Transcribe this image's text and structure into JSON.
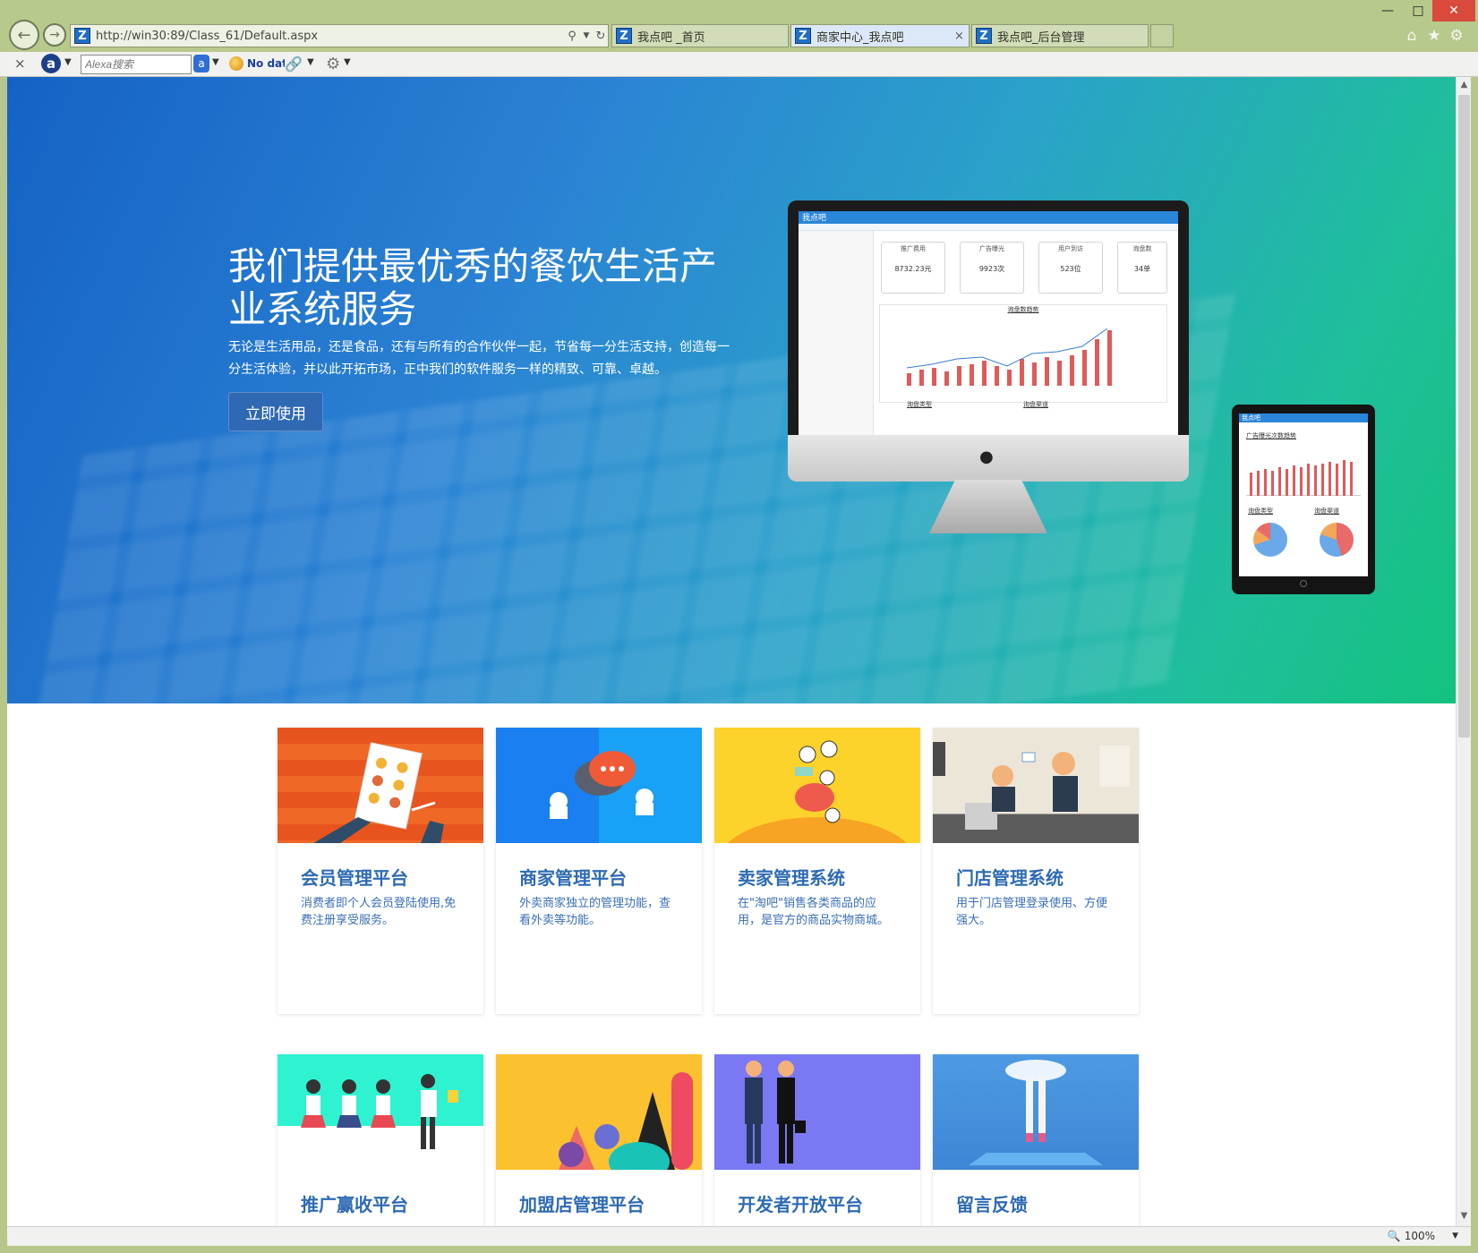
{
  "browser": {
    "url": "http://win30:89/Class_61/Default.aspx",
    "tabs": [
      {
        "label": "我点吧 _首页",
        "active": false
      },
      {
        "label": "商家中心_我点吧",
        "active": true
      },
      {
        "label": "我点吧_后台管理",
        "active": false
      }
    ],
    "toolbar": {
      "alexa_placeholder": "Alexa搜索",
      "no_data": "No data"
    },
    "zoom": "100%"
  },
  "hero": {
    "title": "我们提供最优秀的餐饮生活产业系统服务",
    "subtitle": "无论是生活用品，还是食品，还有与所有的合作伙伴一起，节省每一分生活支持，创造每一分生活体验，并以此开拓市场，正中我们的软件服务一样的精致、可靠、卓越。",
    "button": "立即使用",
    "mock_monitor": {
      "brand": "我点吧",
      "cards": [
        {
          "title": "推广费用",
          "value": "8732.23元"
        },
        {
          "title": "广告曝光",
          "value": "9923次"
        },
        {
          "title": "用户到访",
          "value": "523位"
        },
        {
          "title": "询盘数",
          "value": "34单"
        }
      ],
      "chart_title": "询盘数趋势",
      "sub_titles": [
        "询盘类型",
        "询盘渠道"
      ]
    },
    "mock_tablet": {
      "brand": "我点吧",
      "chart_title": "广告曝光次数趋势",
      "sub_titles": [
        "询盘类型",
        "询盘渠道"
      ]
    }
  },
  "cards": [
    {
      "title": "会员管理平台",
      "desc": "消费者即个人会员登陆使用,免费注册享受服务。",
      "bg": "#e8541e"
    },
    {
      "title": "商家管理平台",
      "desc": "外卖商家独立的管理功能，查看外卖等功能。",
      "bg": "#1a90f0"
    },
    {
      "title": "卖家管理系统",
      "desc": "在\"淘吧\"销售各类商品的应用，是官方的商品实物商城。",
      "bg": "#fdd22b"
    },
    {
      "title": "门店管理系统",
      "desc": "用于门店管理登录使用、方便强大。",
      "bg": "#ece6d9"
    },
    {
      "title": "推广赢收平台",
      "desc": "",
      "bg": "#2ef2d0"
    },
    {
      "title": "加盟店管理平台",
      "desc": "",
      "bg": "#fcc12e"
    },
    {
      "title": "开发者开放平台",
      "desc": "",
      "bg": "#7a78f2"
    },
    {
      "title": "留言反馈",
      "desc": "",
      "bg": "#4d9ae2"
    }
  ]
}
